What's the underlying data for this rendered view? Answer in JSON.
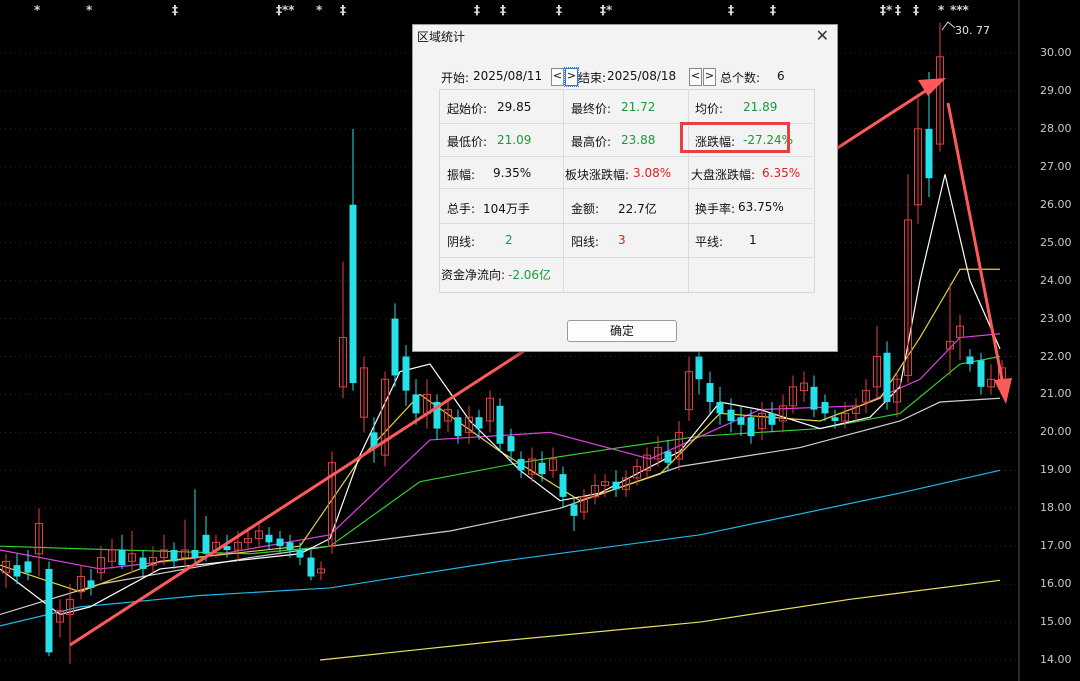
{
  "price_axis": [
    "30.00",
    "29.00",
    "28.00",
    "27.00",
    "26.00",
    "25.00",
    "24.00",
    "23.00",
    "22.00",
    "21.00",
    "20.00",
    "19.00",
    "18.00",
    "17.00",
    "16.00",
    "15.00",
    "14.00"
  ],
  "top_markers": [
    "*",
    "*",
    "‡",
    "‡**",
    "*",
    "‡",
    "‡",
    "‡",
    "‡",
    "‡*",
    "‡",
    "‡",
    "‡*",
    "‡",
    "‡",
    "*",
    "***"
  ],
  "peak_label": "30. 77",
  "colors": {
    "up": "#e04040",
    "down": "#27e1e8",
    "ma5": "#ffffff",
    "ma10": "#e8d23a",
    "ma20": "#e040e0",
    "ma30": "#30d030",
    "ma60": "#cfcfcf",
    "ma120": "#20b8e8",
    "ma250": "#e8e060",
    "annot": "#ff5a5a"
  },
  "dialog": {
    "title": "区域统计",
    "start_label": "开始:",
    "start_date": "2025/08/11",
    "end_label": "结束:",
    "end_date": "2025/08/18",
    "prev": "<",
    "next": ">",
    "count_label": "总个数:",
    "count_value": "6",
    "open_label": "起始价:",
    "open_value": "29.85",
    "close_label": "最终价:",
    "close_value": "21.72",
    "avg_label": "均价:",
    "avg_value": "21.89",
    "low_label": "最低价:",
    "low_value": "21.09",
    "high_label": "最高价:",
    "high_value": "23.88",
    "chg_label": "涨跌幅:",
    "chg_value": "-27.24%",
    "amp_label": "振幅:",
    "amp_value": "9.35%",
    "sector_label": "板块涨跌幅:",
    "sector_value": "3.08%",
    "market_label": "大盘涨跌幅:",
    "market_value": "6.35%",
    "vol_label": "总手:",
    "vol_value": "104万手",
    "amount_label": "金额:",
    "amount_value": "22.7亿",
    "turnover_label": "换手率:",
    "turnover_value": "63.75%",
    "yin_label": "阴线:",
    "yin_value": "2",
    "yang_label": "阳线:",
    "yang_value": "3",
    "flat_label": "平线:",
    "flat_value": "1",
    "flow_label": "资金净流向:",
    "flow_value": "-2.06亿",
    "ok": "确定"
  }
}
